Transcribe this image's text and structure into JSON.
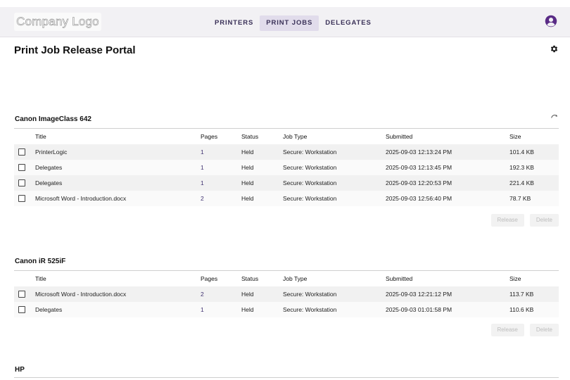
{
  "header": {
    "logo_text": "Company Logo",
    "tabs": [
      {
        "label": "PRINTERS"
      },
      {
        "label": "PRINT JOBS"
      },
      {
        "label": "DELEGATES"
      }
    ],
    "active_tab": "PRINT JOBS",
    "user_icon": "user-circle-icon",
    "accent_color": "#5a2b86"
  },
  "page": {
    "title": "Print Job Release Portal",
    "settings_icon": "gear-icon"
  },
  "columns": {
    "title": "Title",
    "pages": "Pages",
    "status": "Status",
    "job_type": "Job Type",
    "submitted": "Submitted",
    "size": "Size"
  },
  "buttons": {
    "release": "Release",
    "delete": "Delete"
  },
  "printers": [
    {
      "name": "Canon ImageClass 642",
      "jobs": [
        {
          "title": "PrinterLogic",
          "pages": "1",
          "status": "Held",
          "job_type": "Secure: Workstation",
          "submitted": "2025-09-03 12:13:24 PM",
          "size": "101.4 KB",
          "checked": false
        },
        {
          "title": "Delegates",
          "pages": "1",
          "status": "Held",
          "job_type": "Secure: Workstation",
          "submitted": "2025-09-03 12:13:45 PM",
          "size": "192.3 KB",
          "checked": false
        },
        {
          "title": "Delegates",
          "pages": "1",
          "status": "Held",
          "job_type": "Secure: Workstation",
          "submitted": "2025-09-03 12:20:53 PM",
          "size": "221.4 KB",
          "checked": false
        },
        {
          "title": "Microsoft Word - Introduction.docx",
          "pages": "2",
          "status": "Held",
          "job_type": "Secure: Workstation",
          "submitted": "2025-09-03 12:56:40 PM",
          "size": "78.7 KB",
          "checked": false
        }
      ]
    },
    {
      "name": "Canon iR 525iF",
      "jobs": [
        {
          "title": "Microsoft Word - Introduction.docx",
          "pages": "2",
          "status": "Held",
          "job_type": "Secure: Workstation",
          "submitted": "2025-09-03 12:21:12 PM",
          "size": "113.7 KB",
          "checked": false
        },
        {
          "title": "Delegates",
          "pages": "1",
          "status": "Held",
          "job_type": "Secure: Workstation",
          "submitted": "2025-09-03 01:01:58 PM",
          "size": "110.6 KB",
          "checked": false
        }
      ]
    },
    {
      "name": "HP",
      "jobs": []
    }
  ]
}
